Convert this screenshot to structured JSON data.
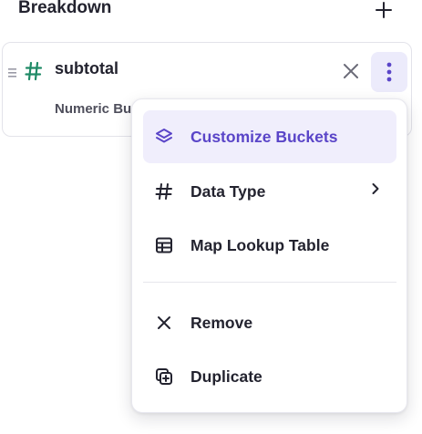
{
  "header": {
    "title": "Breakdown"
  },
  "card": {
    "field_name": "subtotal",
    "subtitle": "Numeric Bu"
  },
  "menu": {
    "items": [
      {
        "label": "Customize Buckets",
        "icon": "layers-icon",
        "active": true
      },
      {
        "label": "Data Type",
        "icon": "hash-icon",
        "has_submenu": true
      },
      {
        "label": "Map Lookup Table",
        "icon": "table-icon"
      },
      {
        "label": "Remove",
        "icon": "close-icon"
      },
      {
        "label": "Duplicate",
        "icon": "duplicate-icon"
      }
    ]
  },
  "colors": {
    "accent": "#5a45c8",
    "accent_bg": "#f0eefc",
    "field_type_green": "#1f8a66",
    "text": "#23232f"
  }
}
